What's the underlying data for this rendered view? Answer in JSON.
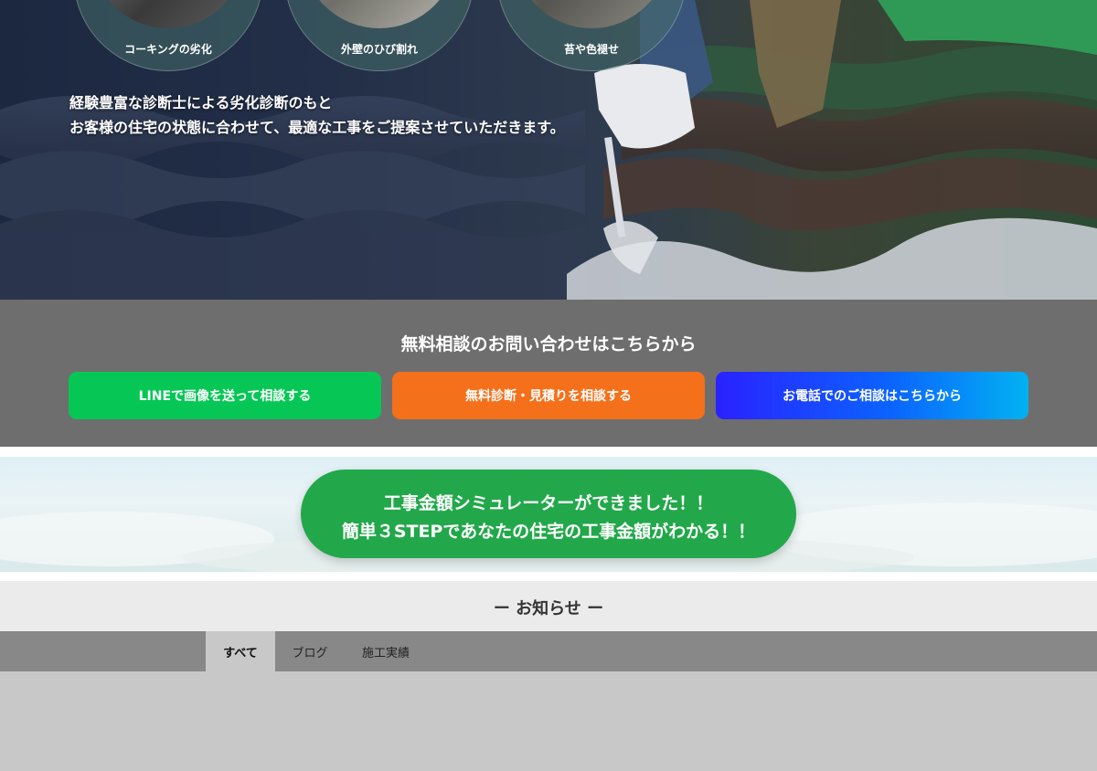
{
  "hero": {
    "circles": [
      {
        "label": "コーキングの劣化"
      },
      {
        "label": "外壁のひび割れ"
      },
      {
        "label": "苔や色褪せ"
      }
    ],
    "text_line1": "経験豊富な診断士による劣化診断のもと",
    "text_line2": "お客様の住宅の状態に合わせて、最適な工事をご提案させていただきます。"
  },
  "contact": {
    "title": "無料相談のお問い合わせはこちらから",
    "buttons": [
      {
        "label": "LINEで画像を送って相談する",
        "color": "#06c755"
      },
      {
        "label": "無料診断・見積りを相談する",
        "color": "#f5701a"
      },
      {
        "label": "お電話でのご相談はこちらから",
        "color": "#0b62ff"
      }
    ]
  },
  "simulator": {
    "line1": "工事金額シミュレーターができました！！",
    "line2": "簡単３STEPであなたの住宅の工事金額がわかる！！",
    "color": "#22a84a"
  },
  "news": {
    "title": "ー お知らせ ー",
    "tabs": [
      {
        "label": "すべて",
        "active": true
      },
      {
        "label": "ブログ",
        "active": false
      },
      {
        "label": "施工実績",
        "active": false
      }
    ]
  }
}
